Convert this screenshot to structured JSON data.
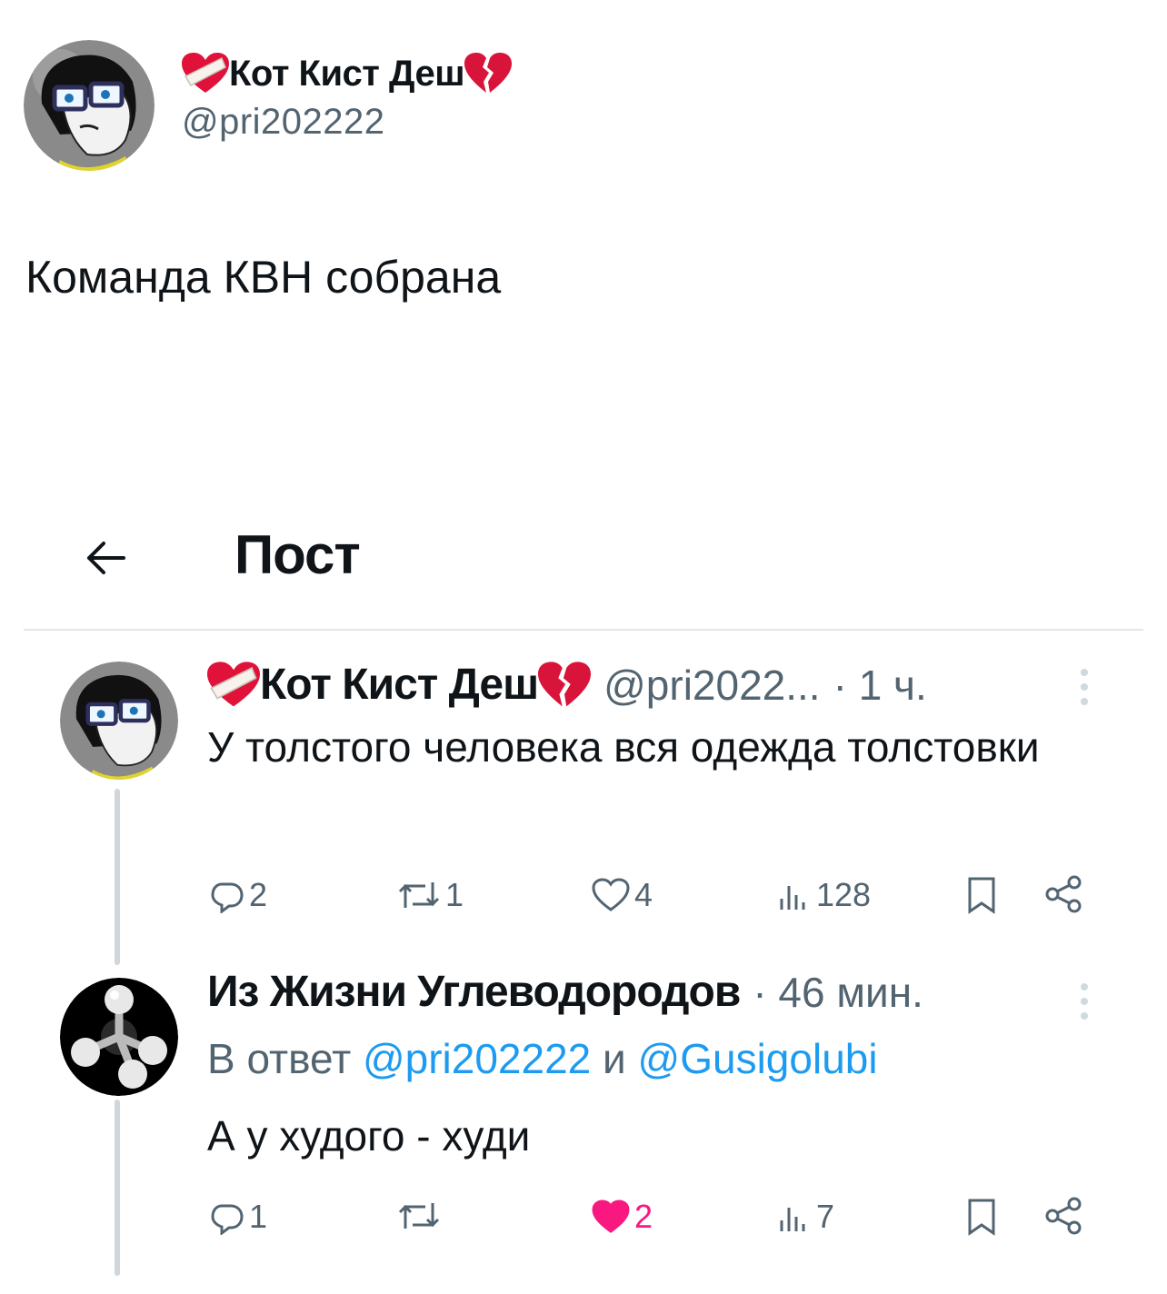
{
  "outer_post": {
    "author_name": "Кот Кист Деш",
    "author_handle": "@pri202222",
    "text": "Команда КВН собрана"
  },
  "screenshot": {
    "header_title": "Пост",
    "tweets": [
      {
        "author_name": "Кот Кист Деш",
        "handle": "@pri2022...",
        "time": "· 1 ч.",
        "text": "У толстого человека вся одежда толстовки",
        "replies": "2",
        "retweets": "1",
        "likes": "4",
        "views": "128",
        "liked": false
      },
      {
        "author_name": "Из Жизни Углеводородов",
        "time": "· 46 мин.",
        "reply_prefix": "В ответ",
        "reply_user1": "@pri202222",
        "reply_and": "и",
        "reply_user2": "@Gusigolubi",
        "text": "А у худого - худи",
        "replies": "1",
        "retweets": "",
        "likes": "2",
        "views": "7",
        "liked": true
      }
    ]
  },
  "colors": {
    "text_primary": "#0f1419",
    "text_secondary": "#536471",
    "link": "#1d9bf0",
    "like": "#f91880",
    "thread_line": "#cfd6dc"
  }
}
